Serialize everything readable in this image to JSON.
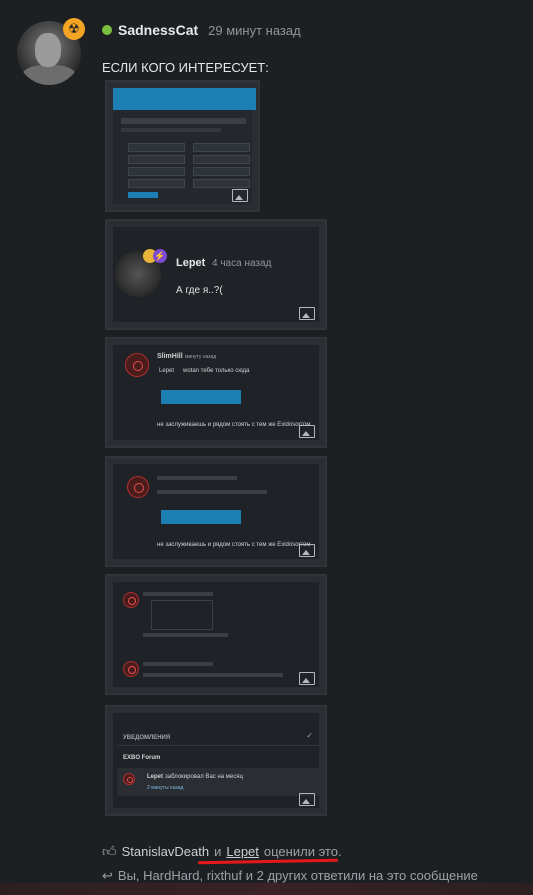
{
  "post": {
    "author": "SadnessCat",
    "time": "29 минут назад",
    "message": "ЕСЛИ КОГО ИНТЕРЕСУЕТ:",
    "status_color": "#7ac142",
    "badge_color": "#f5a524"
  },
  "attachments": {
    "a2": {
      "author": "Lepet",
      "time": "4 часа назад",
      "text": "А где я..?("
    },
    "a3": {
      "author": "SlimHill",
      "time": "минуту назад",
      "quote": "Lepet",
      "quote_text": "wotan тебе только сюда",
      "text": "не заслуживаешь и рядом стоять с тем же Exidoson'ом"
    },
    "a4": {
      "author": "SlimHill",
      "text": "не заслуживаешь и рядом стоять с тем же Exidoson'ом"
    },
    "a6": {
      "heading": "УВЕДОМЛЕНИЯ",
      "forum": "EXBO Forum",
      "notif_user": "Lepet",
      "notif_text": "заблокировал Вас на месяц",
      "notif_time": "2 минуты назад"
    }
  },
  "footer": {
    "user1": "StanislavDeath",
    "conj": "и",
    "user2": "Lepet",
    "liked": "оценили это.",
    "replies": "Вы, HardHard, rixthuf и 2 других ответили на это сообщение"
  }
}
